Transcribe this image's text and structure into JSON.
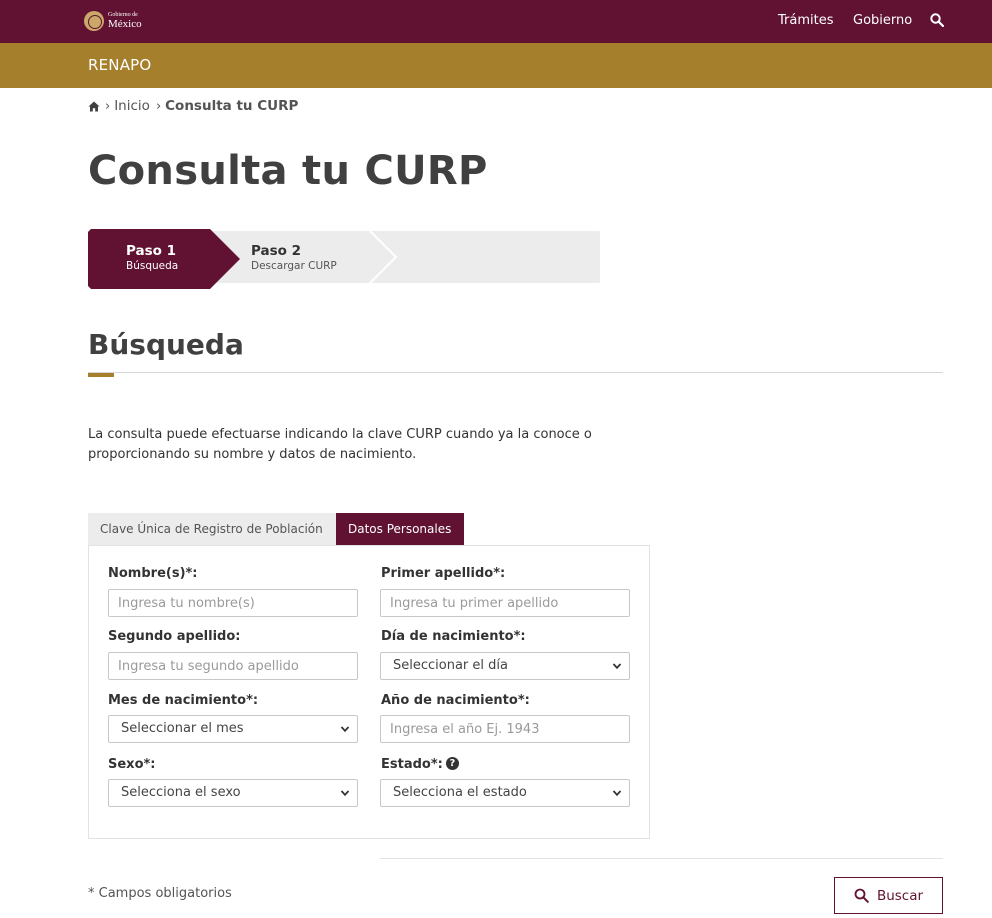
{
  "header": {
    "logo_small": "Gobierno de",
    "logo_big": "México",
    "nav": [
      "Trámites",
      "Gobierno"
    ]
  },
  "subheader": {
    "title": "RENAPO"
  },
  "breadcrumb": {
    "home": "Inicio",
    "current": "Consulta tu CURP"
  },
  "page": {
    "title": "Consulta tu CURP"
  },
  "steps": [
    {
      "label": "Paso 1",
      "sub": "Búsqueda",
      "active": true
    },
    {
      "label": "Paso 2",
      "sub": "Descargar CURP",
      "active": false
    }
  ],
  "section": {
    "title": "Búsqueda",
    "intro": "La consulta puede efectuarse indicando la clave CURP cuando ya la conoce o proporcionando su nombre y datos de nacimiento."
  },
  "tabs": [
    {
      "label": "Clave Única de Registro de Población",
      "active": false
    },
    {
      "label": "Datos Personales",
      "active": true
    }
  ],
  "form": {
    "nombre": {
      "label": "Nombre(s)*:",
      "placeholder": "Ingresa tu nombre(s)"
    },
    "primer_apellido": {
      "label": "Primer apellido*:",
      "placeholder": "Ingresa tu primer apellido"
    },
    "segundo_apellido": {
      "label": "Segundo apellido:",
      "placeholder": "Ingresa tu segundo apellido"
    },
    "dia": {
      "label": "Día de nacimiento*:",
      "selected": "Seleccionar el día"
    },
    "mes": {
      "label": "Mes de nacimiento*:",
      "selected": "Seleccionar el mes"
    },
    "anio": {
      "label": "Año de nacimiento*:",
      "placeholder": "Ingresa el año Ej. 1943"
    },
    "sexo": {
      "label": "Sexo*:",
      "selected": "Selecciona el sexo"
    },
    "estado": {
      "label": "Estado*:",
      "selected": "Selecciona el estado"
    }
  },
  "footer": {
    "required_note": "* Campos obligatorios",
    "search_label": "Buscar"
  },
  "colors": {
    "primary": "#611232",
    "gold": "#a57f2c",
    "gray": "#ececec"
  }
}
